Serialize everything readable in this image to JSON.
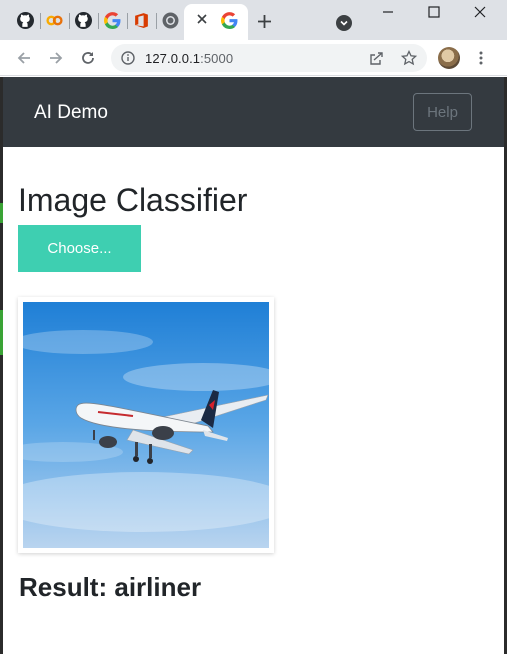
{
  "browser": {
    "tabs": [
      {
        "icon": "github-icon"
      },
      {
        "icon": "colab-icon"
      },
      {
        "icon": "github-icon"
      },
      {
        "icon": "google-icon"
      },
      {
        "icon": "office-icon"
      },
      {
        "icon": "chrome-icon"
      },
      {
        "icon": "close-icon",
        "active": true
      },
      {
        "icon": "google-icon"
      }
    ],
    "url_host": "127.0.0.1",
    "url_port": ":5000"
  },
  "navbar": {
    "brand": "AI Demo",
    "help_label": "Help"
  },
  "main": {
    "title": "Image Classifier",
    "choose_label": "Choose...",
    "image": {
      "subject": "airliner in flight",
      "sky_color": "#2f8fdb"
    },
    "result_label": "Result:",
    "result_value": "airliner"
  },
  "colors": {
    "navbar_bg": "#343a40",
    "choose_btn": "#3ecfb1",
    "help_border": "#6c757d"
  }
}
